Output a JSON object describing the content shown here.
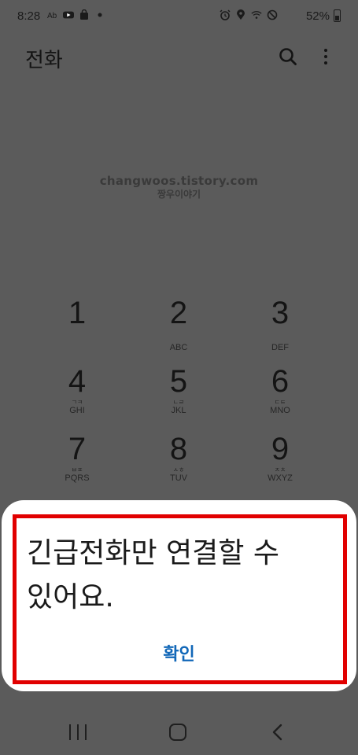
{
  "status_bar": {
    "time": "8:28",
    "battery": "52%",
    "left_icons": [
      "notification-a-icon",
      "youtube-icon",
      "shopping-bag-icon",
      "dot-icon"
    ],
    "right_icons": [
      "alarm-icon",
      "location-icon",
      "wifi-icon",
      "do-not-disturb-icon"
    ]
  },
  "app_bar": {
    "title": "전화",
    "actions": [
      "search-icon",
      "more-options-icon"
    ]
  },
  "watermark": {
    "line1": "changwoos.tistory.com",
    "line2": "짱우이야기"
  },
  "keypad": {
    "keys": [
      {
        "digit": "1",
        "ko": "",
        "letters": ""
      },
      {
        "digit": "2",
        "ko": "",
        "letters": "ABC"
      },
      {
        "digit": "3",
        "ko": "",
        "letters": "DEF"
      },
      {
        "digit": "4",
        "ko": "ㄱㅋ",
        "letters": "GHI"
      },
      {
        "digit": "5",
        "ko": "ㄴㄹ",
        "letters": "JKL"
      },
      {
        "digit": "6",
        "ko": "ㄷㅌ",
        "letters": "MNO"
      },
      {
        "digit": "7",
        "ko": "ㅂㅍ",
        "letters": "PQRS"
      },
      {
        "digit": "8",
        "ko": "ㅅㅎ",
        "letters": "TUV"
      },
      {
        "digit": "9",
        "ko": "ㅈㅊ",
        "letters": "WXYZ"
      }
    ]
  },
  "dialog": {
    "message_line1": "긴급전화만 연결할 수",
    "message_line2": "있어요.",
    "confirm_label": "확인",
    "highlight_color": "#e10000",
    "accent_color": "#1167b8"
  },
  "nav_bar": {
    "buttons": [
      "recents-icon",
      "home-icon",
      "back-icon"
    ]
  }
}
